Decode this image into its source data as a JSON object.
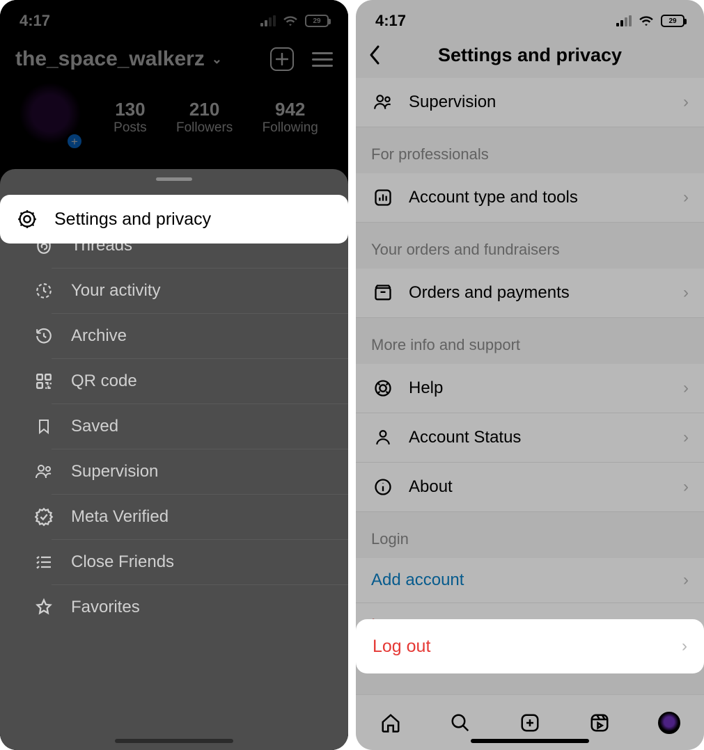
{
  "status": {
    "time": "4:17",
    "battery": "29"
  },
  "left": {
    "username": "the_space_walkerz",
    "stats": {
      "posts": {
        "num": "130",
        "label": "Posts"
      },
      "followers": {
        "num": "210",
        "label": "Followers"
      },
      "following": {
        "num": "942",
        "label": "Following"
      }
    },
    "highlight_label": "Settings and privacy",
    "menu": [
      {
        "label": "Settings and privacy",
        "icon": "gear-icon"
      },
      {
        "label": "Threads",
        "icon": "threads-icon"
      },
      {
        "label": "Your activity",
        "icon": "clock-dashed-icon"
      },
      {
        "label": "Archive",
        "icon": "archive-icon"
      },
      {
        "label": "QR code",
        "icon": "qr-icon"
      },
      {
        "label": "Saved",
        "icon": "bookmark-icon"
      },
      {
        "label": "Supervision",
        "icon": "people-icon"
      },
      {
        "label": "Meta Verified",
        "icon": "verified-icon"
      },
      {
        "label": "Close Friends",
        "icon": "list-star-icon"
      },
      {
        "label": "Favorites",
        "icon": "star-icon"
      }
    ]
  },
  "right": {
    "title": "Settings and privacy",
    "rows": {
      "supervision": "Supervision",
      "account_type": "Account type and tools",
      "orders": "Orders and payments",
      "help": "Help",
      "account_status": "Account Status",
      "about": "About",
      "add_account": "Add account",
      "logout": "Log out"
    },
    "sections": {
      "professionals": "For professionals",
      "orders_section": "Your orders and fundraisers",
      "support": "More info and support",
      "login": "Login"
    },
    "highlight_logout": "Log out"
  }
}
